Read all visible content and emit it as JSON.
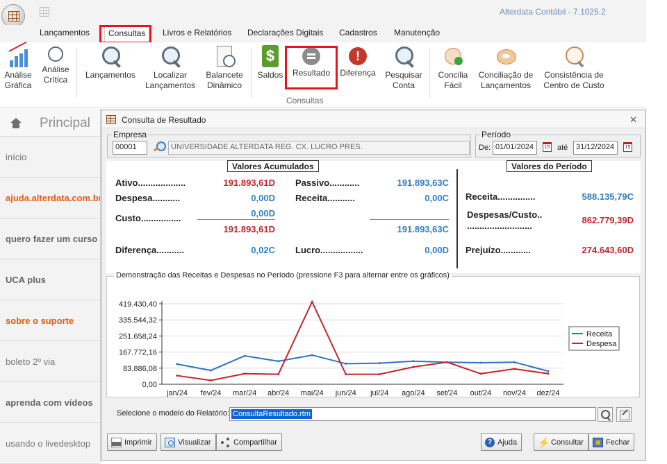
{
  "app": {
    "title": "Alterdata Contábil - 7.1025.2"
  },
  "menu": {
    "tabs": [
      {
        "label": "Lançamentos"
      },
      {
        "label": "Consultas"
      },
      {
        "label": "Livros e Relatórios"
      },
      {
        "label": "Declarações Digitais"
      },
      {
        "label": "Cadastros"
      },
      {
        "label": "Manutenção"
      }
    ]
  },
  "ribbon": {
    "buttons": [
      {
        "label": "Análise\nGráfica",
        "icon": "bar-chart-icon"
      },
      {
        "label": "Análise\nCrítica",
        "icon": "lightbulb-icon"
      },
      {
        "label": "Lançamentos",
        "icon": "magnifier-icon"
      },
      {
        "label": "Localizar\nLançamentos",
        "icon": "magnifier-icon"
      },
      {
        "label": "Balancete\nDinâmico",
        "icon": "document-gear-icon"
      },
      {
        "label": "Saldos",
        "icon": "dollar-icon"
      },
      {
        "label": "Resultado",
        "icon": "equal-sign-icon"
      },
      {
        "label": "Diferença",
        "icon": "exclamation-icon"
      },
      {
        "label": "Pesquisar\nConta",
        "icon": "document-search-icon"
      },
      {
        "label": "Concilia\nFácil",
        "icon": "pen-check-icon"
      },
      {
        "label": "Conciliação de\nLançamentos",
        "icon": "disc-icon"
      },
      {
        "label": "Consistência de\nCentro de Custo",
        "icon": "coin-search-icon"
      }
    ],
    "group_label": "Consultas"
  },
  "sidebar": {
    "title": "Principal",
    "items": [
      {
        "label": "início",
        "style": "plain"
      },
      {
        "label": "ajuda.alterdata.com.br",
        "style": "orange"
      },
      {
        "label": "quero fazer um curso",
        "style": "bold"
      },
      {
        "label": "UCA plus",
        "style": "bold"
      },
      {
        "label": "sobre o suporte",
        "style": "orange"
      },
      {
        "label": "boleto 2º via",
        "style": "plain"
      },
      {
        "label": "aprenda com vídeos",
        "style": "bold"
      },
      {
        "label": "usando o livedesktop",
        "style": "plain"
      }
    ]
  },
  "dialog": {
    "title": "Consulta de Resultado",
    "close_glyph": "✕",
    "empresa": {
      "legend": "Empresa",
      "code": "00001",
      "name": "UNIVERSIDADE ALTERDATA REG. CX. LUCRO PRES."
    },
    "periodo": {
      "legend": "Período",
      "de_label": "De:",
      "de_value": "01/01/2024",
      "ate_label": "até",
      "ate_value": "31/12/2024",
      "cal_glyph": "15"
    },
    "acumulados": {
      "heading": "Valores Acumulados",
      "ativo_label": "Ativo...................",
      "ativo_value": "191.893,61D",
      "passivo_label": "Passivo............",
      "passivo_value": "191.893,63C",
      "despesa_label": "Despesa...........",
      "despesa_value": "0,00D",
      "receita_label": "Receita...........",
      "receita_value": "0,00C",
      "custo_label": "Custo................",
      "custo_value": "0,00D",
      "subtotal_left": "191.893,61D",
      "subtotal_right": "191.893,63C",
      "diferenca_label": "Diferença...........",
      "diferenca_value": "0,02C",
      "lucro_label": "Lucro.................",
      "lucro_value": "0,00D"
    },
    "periodo_valores": {
      "heading": "Valores do Período",
      "receita_label": "Receita...............",
      "receita_value": "588.135,79C",
      "despesas_label_1": "Despesas/Custo..",
      "despesas_label_2": "..........................",
      "despesas_value": "862.779,39D",
      "prejuizo_label": "Prejuízo............",
      "prejuizo_value": "274.643,60D"
    },
    "chart_title": "Demonstração das Receitas e Despesas no Período (pressione F3 para alternar entre os gráficos)",
    "model": {
      "label": "Selecione o modelo do Relatório:",
      "value": "ConsultaResultado.rtm"
    },
    "buttons": {
      "imprimir": "Imprimir",
      "visualizar": "Visualizar",
      "compartilhar": "Compartilhar",
      "ajuda": "Ajuda",
      "consultar": "Consultar",
      "fechar": "Fechar"
    }
  },
  "chart_data": {
    "type": "line",
    "categories": [
      "jan/24",
      "fev/24",
      "mar/24",
      "abr/24",
      "mai/24",
      "jun/24",
      "jul/24",
      "ago/24",
      "set/24",
      "out/24",
      "nov/24",
      "dez/24"
    ],
    "yticks": [
      "0,00",
      "83.886,08",
      "167.772,16",
      "251.658,24",
      "335.544,32",
      "419.430,40"
    ],
    "ylim": [
      0,
      419430.4
    ],
    "series": [
      {
        "name": "Receita",
        "color": "#2e72bf",
        "values": [
          105000,
          72000,
          148000,
          120000,
          152000,
          107000,
          110000,
          120000,
          115000,
          112000,
          115000,
          68000
        ]
      },
      {
        "name": "Despesa",
        "color": "#c0262e",
        "values": [
          45000,
          20000,
          55000,
          52000,
          430000,
          52000,
          52000,
          90000,
          115000,
          55000,
          80000,
          55000
        ]
      }
    ],
    "legend_position": "right",
    "grid": true
  }
}
